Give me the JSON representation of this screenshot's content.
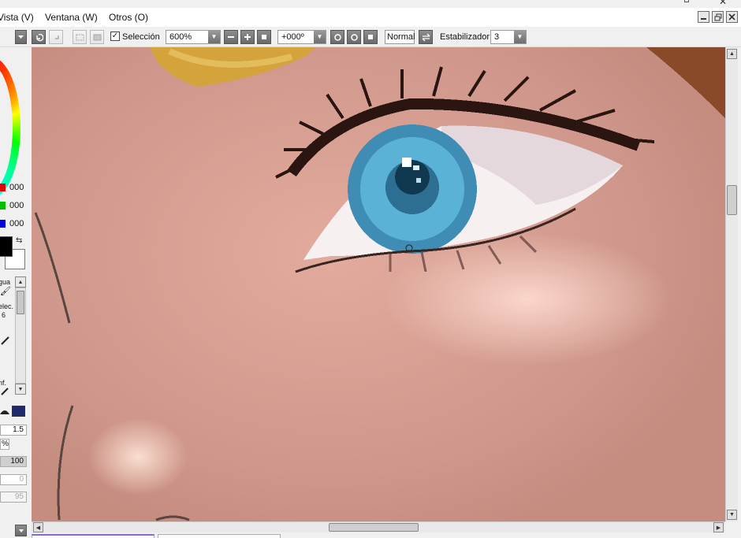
{
  "menu": {
    "items": [
      "Vista (V)",
      "Ventana (W)",
      "Otros (O)"
    ],
    "close_glyph": "✕"
  },
  "window_controls": {
    "minimize_icon": "minimize-icon",
    "restore_icon": "restore-icon",
    "close_icon": "close-icon"
  },
  "toolbar": {
    "selection_checked": true,
    "selection_label": "Selección",
    "zoom_value": "600%",
    "rotation_value": "+000º",
    "blend_mode": "Normal",
    "stabilizer_label": "Estabilizador",
    "stabilizer_value": "3"
  },
  "color_panel": {
    "r_value": "000",
    "g_value": "000",
    "b_value": "000",
    "r_color": "#e00000",
    "g_color": "#00c000",
    "b_color": "#0000e0",
    "fg_color": "#000000",
    "bg_color": "#ffffff"
  },
  "tool_panel": {
    "label_water": "gua",
    "label_select": "elec.",
    "label_select2": "6",
    "label_blur": "nf."
  },
  "brush_settings": {
    "size": "1.5",
    "size_unit": "%",
    "density": "100",
    "min_size": "0",
    "min_density": "95"
  },
  "canvas": {
    "skin_color": "#d8a193",
    "iris_color": "#4aa6c8",
    "hair_color": "#d2a640"
  }
}
